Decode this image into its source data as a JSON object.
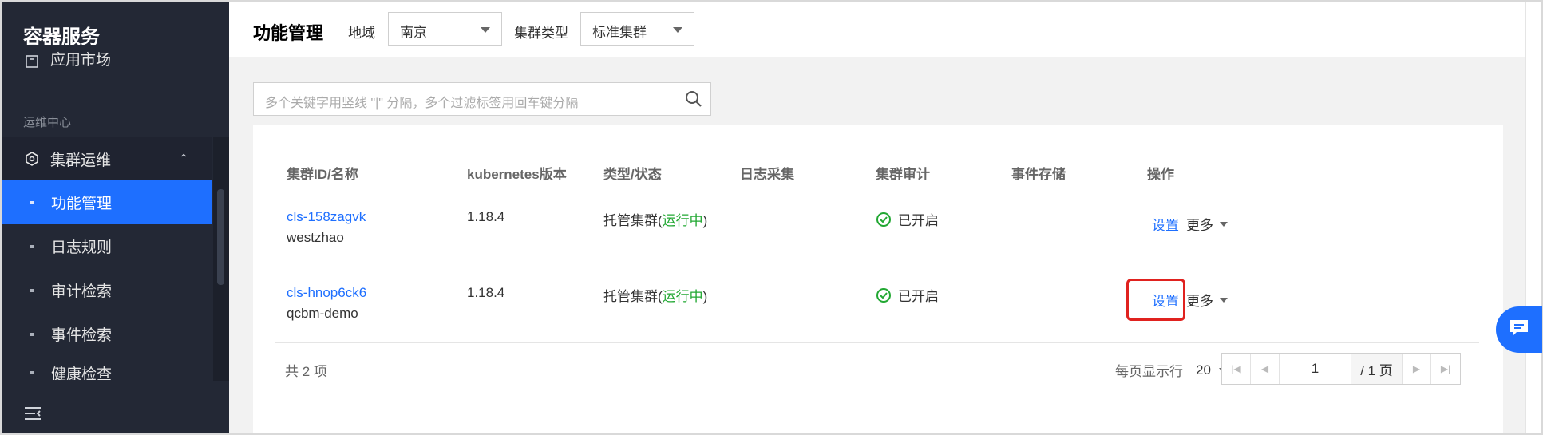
{
  "sidebar": {
    "title": "容器服务",
    "partial_item": "应用市场",
    "section_label": "运维中心",
    "group": {
      "label": "集群运维",
      "expanded": true
    },
    "items": [
      {
        "label": "功能管理",
        "active": true
      },
      {
        "label": "日志规则",
        "active": false
      },
      {
        "label": "审计检索",
        "active": false
      },
      {
        "label": "事件检索",
        "active": false
      },
      {
        "label": "健康检查",
        "active": false
      }
    ]
  },
  "header": {
    "title": "功能管理",
    "region_label": "地域",
    "region_value": "南京",
    "cluster_type_label": "集群类型",
    "cluster_type_value": "标准集群"
  },
  "search": {
    "placeholder": "多个关键字用竖线 \"|\" 分隔，多个过滤标签用回车键分隔"
  },
  "table": {
    "columns": [
      "集群ID/名称",
      "kubernetes版本",
      "类型/状态",
      "日志采集",
      "集群审计",
      "事件存储",
      "操作"
    ],
    "rows": [
      {
        "cluster_id": "cls-158zagvk",
        "cluster_name": "westzhao",
        "version": "1.18.4",
        "type": "托管集群(",
        "status": "运行中",
        "type_close": ")",
        "log_collection": "",
        "audit": "已开启",
        "event_storage": "",
        "action_settings": "设置",
        "action_more": "更多"
      },
      {
        "cluster_id": "cls-hnop6ck6",
        "cluster_name": "qcbm-demo",
        "version": "1.18.4",
        "type": "托管集群(",
        "status": "运行中",
        "type_close": ")",
        "log_collection": "",
        "audit": "已开启",
        "event_storage": "",
        "action_settings": "设置",
        "action_more": "更多"
      }
    ]
  },
  "footer": {
    "total": "共 2 项",
    "per_page_label": "每页显示行",
    "per_page_value": "20",
    "current_page": "1",
    "total_pages": "/ 1 页"
  },
  "colors": {
    "sidebar_bg": "#232835",
    "accent": "#1e6fff",
    "running_green": "#22a833",
    "highlight_red": "#e0221f"
  }
}
